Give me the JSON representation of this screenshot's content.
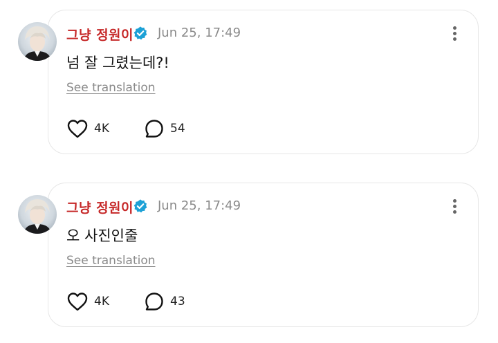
{
  "posts": [
    {
      "author": "그냥 정원이",
      "timestamp": "Jun 25, 17:49",
      "text": "넘 잘 그렸는데?!",
      "translate_label": "See translation",
      "likes": "4K",
      "replies": "54"
    },
    {
      "author": "그냥 정원이",
      "timestamp": "Jun 25, 17:49",
      "text": "오 사진인줄",
      "translate_label": "See translation",
      "likes": "4K",
      "replies": "43"
    }
  ],
  "icons": {
    "verified": "verified-badge-icon",
    "more": "more-vertical-icon",
    "like": "heart-icon",
    "reply": "speech-bubble-icon"
  },
  "colors": {
    "author_name": "#c62828",
    "verified_badge": "#1da1d6",
    "secondary_text": "#8a8a8a",
    "card_border": "#e6e6e6"
  }
}
